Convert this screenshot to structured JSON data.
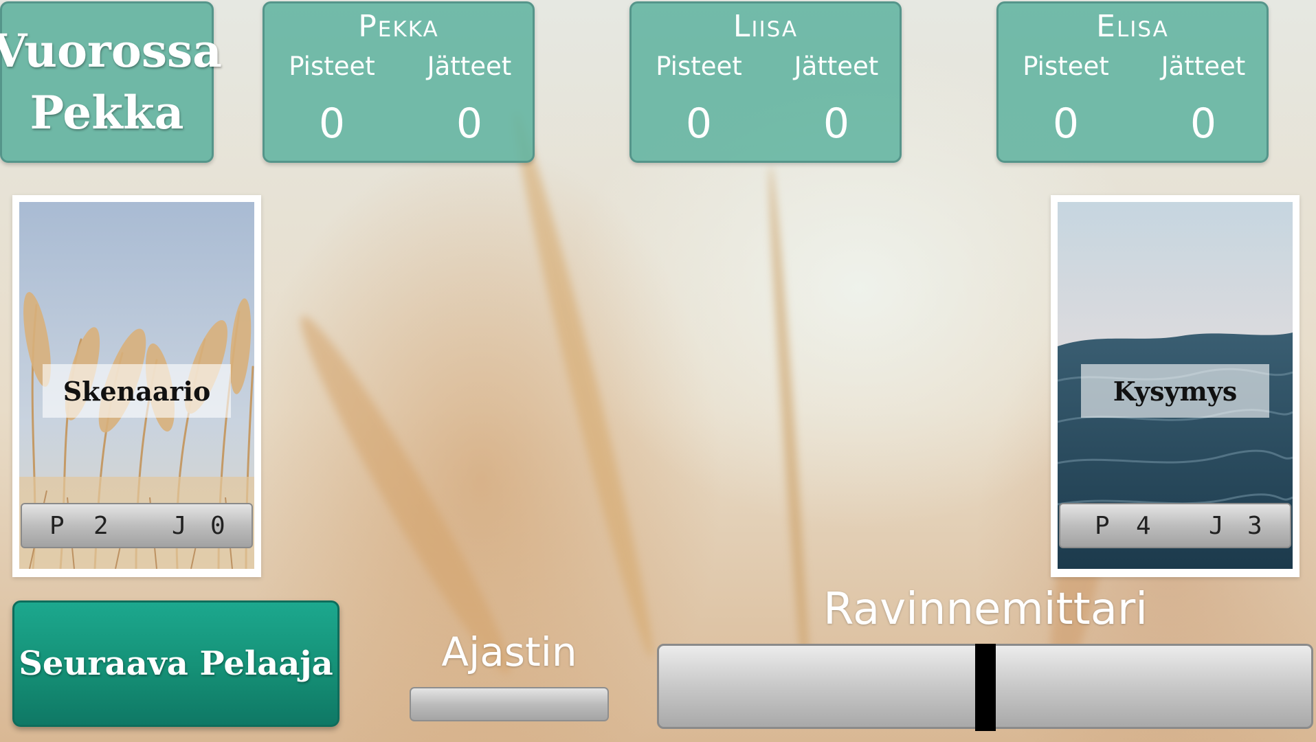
{
  "turn": {
    "line1": "Vuorossa",
    "line2": "Pekka"
  },
  "players": [
    {
      "name": "Pekka",
      "points_label": "Pisteet",
      "waste_label": "Jätteet",
      "points": "0",
      "waste": "0"
    },
    {
      "name": "Liisa",
      "points_label": "Pisteet",
      "waste_label": "Jätteet",
      "points": "0",
      "waste": "0"
    },
    {
      "name": "Elisa",
      "points_label": "Pisteet",
      "waste_label": "Jätteet",
      "points": "0",
      "waste": "0"
    }
  ],
  "decks": {
    "scenario": {
      "label": "Skenaario",
      "p_label": "P",
      "p_value": "2",
      "j_label": "J",
      "j_value": "0"
    },
    "question": {
      "label": "Kysymys",
      "p_label": "P",
      "p_value": "4",
      "j_label": "J",
      "j_value": "3"
    }
  },
  "next_player": {
    "label": "Seuraava Pelaaja"
  },
  "timer": {
    "label": "Ajastin"
  },
  "nutrition_meter": {
    "label": "Ravinnemittari",
    "level": 0.5
  },
  "colors": {
    "panel": "#6fb8a6",
    "button": "#159076",
    "indicator": "#000000"
  }
}
